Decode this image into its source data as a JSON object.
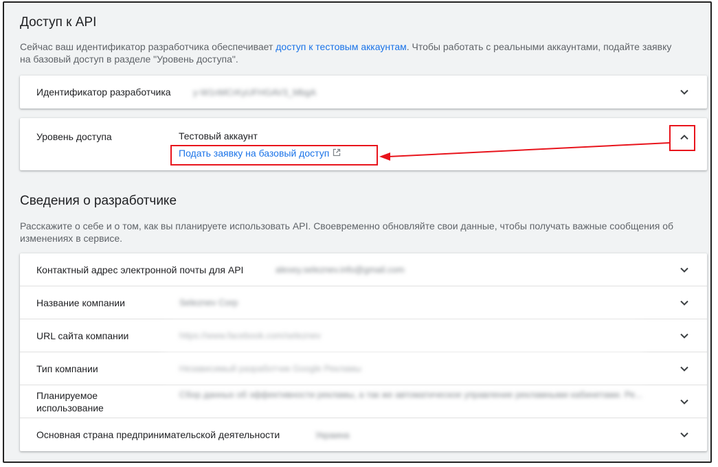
{
  "api_access": {
    "title": "Доступ к API",
    "description_prefix": "Сейчас ваш идентификатор разработчика обеспечивает ",
    "description_link": "доступ к тестовым аккаунтам",
    "description_suffix": ". Чтобы работать с реальными аккаунтами, подайте заявку на базовый доступ в разделе \"Уровень доступа\".",
    "developer_id": {
      "label": "Идентификатор разработчика",
      "value": "y-W1nMCrKyUFHGAV3_MbgA"
    },
    "access_level": {
      "label": "Уровень доступа",
      "value": "Тестовый аккаунт",
      "apply_link": "Подать заявку на базовый доступ"
    }
  },
  "developer_info": {
    "title": "Сведения о разработчике",
    "description": "Расскажите о себе и о том, как вы планируете использовать API. Своевременно обновляйте свои данные, чтобы получать важные сообщения об изменениях в сервисе.",
    "rows": [
      {
        "label": "Контактный адрес электронной почты для API",
        "value": "alexey.seleznev.info@gmail.com"
      },
      {
        "label": "Название компании",
        "value": "Seleznev Corp"
      },
      {
        "label": "URL сайта компании",
        "value": "https://www.facebook.com/seleznev"
      },
      {
        "label": "Тип компании",
        "value": "Независимый разработчик Google Рекламы"
      },
      {
        "label": "Планируемое использование",
        "value": "Сбор данных об эффективности рекламы, а так же автоматическое управление рекламными кабинетами. Ре..."
      },
      {
        "label": "Основная страна предпринимательской деятельности",
        "value": "Украина"
      }
    ]
  },
  "colors": {
    "link": "#1a73e8",
    "annotation": "#e8141c",
    "background": "#f1f3f4"
  }
}
